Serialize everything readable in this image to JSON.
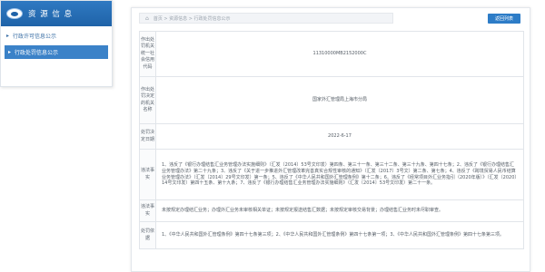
{
  "sidebar": {
    "title": "资 源 信 息",
    "items": [
      {
        "label": "行政许可信息公示",
        "active": false
      },
      {
        "label": "行政处罚信息公示",
        "active": true
      }
    ]
  },
  "breadcrumb": {
    "text": "首页 > 资源信息 > 行政处罚信息公示"
  },
  "back_label": "返回列表",
  "detail": {
    "rows": [
      {
        "label": "作出处罚机关统一社会信用代码",
        "value": "11310000MB2152000C"
      },
      {
        "label": "作出处罚决定的机关名称",
        "value": "国家外汇管理局上海市分局"
      },
      {
        "label": "处罚决定日期",
        "value": "2022-6-17"
      },
      {
        "label": "违法事实",
        "value": "1、违反了《银行办理结售汇业务管理办法实施细则》（汇发〔2014〕53号文印发）第四条、第三十一条、第三十二条、第三十九条、第四十七条；2、违反了《银行办理结售汇业务管理办法》第二十九条；3、违反了《关于进一步推进外汇管理改革完善真实合规性审核的通知》（汇发〔2017〕3号文）第二条、第七条；4、违反了《跨境贸易人民币结算业务管理办法》（汇发〔2014〕29号文印发）第一条；5、违反了《中华人民共和国外汇管理条例》第十二条；6、违反了《经常项目外汇业务指引（2020年版）》（汇发〔2020〕14号文印发）第四十五条、第十九条；7、违反了《银行办理结售汇业务管理办法实施细则》（汇发〔2014〕53号文印发）第二十一条。"
      },
      {
        "label": "违法事实",
        "value": "未按规定办理结汇业务；办理外汇业务未审核相关单证；未按规定报送结售汇数据；未按规定审核交易背景；办理结售汇业务时未尽职审查。"
      },
      {
        "label": "处罚依据",
        "value": "1、《中华人民共和国外汇管理条例》第四十七条第三项；2、《中华人民共和国外汇管理条例》第四十七条第一项；3、《中华人民共和国外汇管理条例》第四十七条第三项。"
      }
    ]
  },
  "colors": {
    "header_blue": "#1f63a8",
    "active_item": "#3b82c8",
    "button_blue": "#2d7cc7",
    "border": "#e1e5ea"
  },
  "icons": [
    "logo-icon",
    "arrow-right-icon",
    "home-icon"
  ]
}
